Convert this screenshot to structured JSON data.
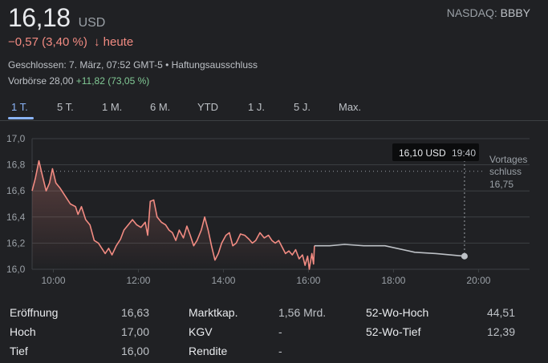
{
  "header": {
    "price": "16,18",
    "currency": "USD",
    "exchange_prefix": "NASDAQ: ",
    "symbol": "BBBY",
    "change_text": "−0,57 (3,40 %)",
    "change_arrow": "↓",
    "change_suffix": "heute",
    "closed_info": "Geschlossen: 7. März, 07:52 GMT-5 • Haftungsausschluss",
    "premarket_label": "Vorbörse 28,00",
    "premarket_change": "+11,82 (73,05 %)"
  },
  "tabs": [
    {
      "label": "1 T.",
      "active": true
    },
    {
      "label": "5 T.",
      "active": false
    },
    {
      "label": "1 M.",
      "active": false
    },
    {
      "label": "6 M.",
      "active": false
    },
    {
      "label": "YTD",
      "active": false
    },
    {
      "label": "1 J.",
      "active": false
    },
    {
      "label": "5 J.",
      "active": false
    },
    {
      "label": "Max.",
      "active": false
    }
  ],
  "tooltip": {
    "value": "16,10 USD",
    "time": "19:40"
  },
  "prev_close": {
    "line1": "Vortages",
    "line2": "schluss",
    "value": "16,75"
  },
  "chart_data": {
    "type": "line",
    "title": "",
    "xlabel": "",
    "ylabel": "",
    "x_unit": "hours",
    "ylim": [
      16.0,
      17.0
    ],
    "xlim": [
      9.5,
      21.2
    ],
    "y_ticks": [
      {
        "value": 17.0,
        "label": "17,0"
      },
      {
        "value": 16.8,
        "label": "16,8"
      },
      {
        "value": 16.6,
        "label": "16,6"
      },
      {
        "value": 16.4,
        "label": "16,4"
      },
      {
        "value": 16.2,
        "label": "16,2"
      },
      {
        "value": 16.0,
        "label": "16,0"
      }
    ],
    "x_ticks": [
      {
        "value": 10,
        "label": "10:00"
      },
      {
        "value": 12,
        "label": "12:00"
      },
      {
        "value": 14,
        "label": "14:00"
      },
      {
        "value": 16,
        "label": "16:00"
      },
      {
        "value": 18,
        "label": "18:00"
      },
      {
        "value": 20,
        "label": "20:00"
      }
    ],
    "grid": true,
    "reference_line": 16.75,
    "regular_session": [
      [
        9.5,
        16.6
      ],
      [
        9.58,
        16.7
      ],
      [
        9.66,
        16.83
      ],
      [
        9.74,
        16.72
      ],
      [
        9.83,
        16.6
      ],
      [
        9.91,
        16.66
      ],
      [
        9.98,
        16.77
      ],
      [
        10.06,
        16.66
      ],
      [
        10.16,
        16.62
      ],
      [
        10.28,
        16.56
      ],
      [
        10.4,
        16.5
      ],
      [
        10.52,
        16.48
      ],
      [
        10.58,
        16.42
      ],
      [
        10.66,
        16.48
      ],
      [
        10.76,
        16.38
      ],
      [
        10.86,
        16.34
      ],
      [
        10.96,
        16.22
      ],
      [
        11.06,
        16.2
      ],
      [
        11.14,
        16.16
      ],
      [
        11.22,
        16.12
      ],
      [
        11.3,
        16.16
      ],
      [
        11.38,
        16.11
      ],
      [
        11.48,
        16.18
      ],
      [
        11.58,
        16.23
      ],
      [
        11.66,
        16.3
      ],
      [
        11.76,
        16.34
      ],
      [
        11.86,
        16.38
      ],
      [
        11.96,
        16.34
      ],
      [
        12.06,
        16.32
      ],
      [
        12.16,
        16.36
      ],
      [
        12.22,
        16.26
      ],
      [
        12.28,
        16.52
      ],
      [
        12.36,
        16.53
      ],
      [
        12.44,
        16.4
      ],
      [
        12.54,
        16.36
      ],
      [
        12.64,
        16.34
      ],
      [
        12.72,
        16.3
      ],
      [
        12.8,
        16.28
      ],
      [
        12.88,
        16.22
      ],
      [
        12.96,
        16.3
      ],
      [
        13.06,
        16.24
      ],
      [
        13.14,
        16.33
      ],
      [
        13.22,
        16.26
      ],
      [
        13.3,
        16.18
      ],
      [
        13.38,
        16.22
      ],
      [
        13.48,
        16.3
      ],
      [
        13.56,
        16.4
      ],
      [
        13.64,
        16.3
      ],
      [
        13.72,
        16.18
      ],
      [
        13.8,
        16.07
      ],
      [
        13.88,
        16.12
      ],
      [
        13.96,
        16.2
      ],
      [
        14.06,
        16.26
      ],
      [
        14.14,
        16.28
      ],
      [
        14.22,
        16.18
      ],
      [
        14.3,
        16.2
      ],
      [
        14.4,
        16.27
      ],
      [
        14.5,
        16.26
      ],
      [
        14.6,
        16.23
      ],
      [
        14.68,
        16.2
      ],
      [
        14.76,
        16.22
      ],
      [
        14.86,
        16.28
      ],
      [
        14.96,
        16.24
      ],
      [
        15.06,
        16.26
      ],
      [
        15.14,
        16.22
      ],
      [
        15.22,
        16.2
      ],
      [
        15.3,
        16.22
      ],
      [
        15.38,
        16.17
      ],
      [
        15.46,
        16.12
      ],
      [
        15.54,
        16.14
      ],
      [
        15.62,
        16.11
      ],
      [
        15.7,
        16.15
      ],
      [
        15.78,
        16.08
      ],
      [
        15.86,
        16.11
      ],
      [
        15.92,
        16.03
      ],
      [
        15.98,
        16.1
      ],
      [
        16.02,
        16.0
      ],
      [
        16.08,
        16.12
      ],
      [
        16.12,
        16.04
      ],
      [
        16.14,
        16.18
      ]
    ],
    "after_hours": [
      [
        16.14,
        16.18
      ],
      [
        16.5,
        16.18
      ],
      [
        16.85,
        16.19
      ],
      [
        17.3,
        16.18
      ],
      [
        17.8,
        16.18
      ],
      [
        18.5,
        16.13
      ],
      [
        19.0,
        16.12
      ],
      [
        19.67,
        16.1
      ]
    ],
    "marker": {
      "x": 19.67,
      "y": 16.1
    }
  },
  "stats": {
    "col1": [
      {
        "label": "Eröffnung",
        "value": "16,63"
      },
      {
        "label": "Hoch",
        "value": "17,00"
      },
      {
        "label": "Tief",
        "value": "16,00"
      }
    ],
    "col2": [
      {
        "label": "Marktkap.",
        "value": "1,56 Mrd."
      },
      {
        "label": "KGV",
        "value": "-"
      },
      {
        "label": "Rendite",
        "value": "-"
      }
    ],
    "col3": [
      {
        "label": "52-Wo-Hoch",
        "value": "44,51"
      },
      {
        "label": "52-Wo-Tief",
        "value": "12,39"
      }
    ]
  },
  "colors": {
    "down": "#f28b82",
    "up": "#81c995",
    "accent": "#8ab4f8",
    "after_hours_line": "#bdc1c6",
    "grid": "#3c4043",
    "background": "#202124"
  }
}
